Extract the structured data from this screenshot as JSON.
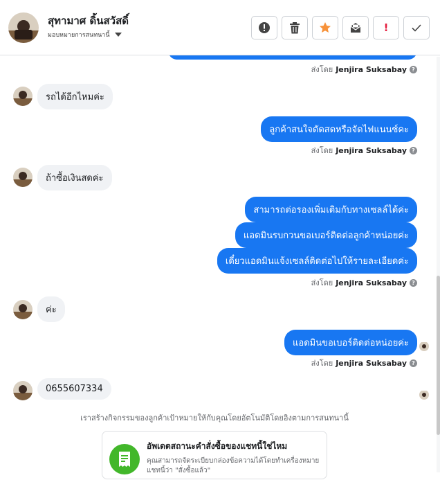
{
  "header": {
    "contact_name": "สุทามาศ ดิ้นสวัสดิ์",
    "assign_label": "มอบหมายการสนทนานี้"
  },
  "toolbar": {
    "buttons": [
      "info",
      "delete",
      "star",
      "mark-unread",
      "spam",
      "done"
    ],
    "spam_label": "!"
  },
  "messages": {
    "sender_prefix": "ส่งโดย",
    "sender_name": "Jenjira Suksabay",
    "help": "?",
    "m1": "รถได้อีกไหมค่ะ",
    "m2": "ลูกค้าสนใจดัดสดหรือจัดไฟแนนซ์คะ",
    "m3": "ถ้าซื้อเงินสดค่ะ",
    "m4": "สามารถต่อรองเพิ่มเติมกับทางเซลล์ได้ค่ะ",
    "m5": "แอดมินรบกวนขอเบอร์ติดต่อลูกค้าหน่อยค่ะ",
    "m6": "เดี๋ยวแอดมินแจ้งเซลล์ติดต่อไปให้รายละเอียดค่ะ",
    "m7": "ค่ะ",
    "m8": "แอดมินขอเบอร์ติดต่อหน่อยค่ะ",
    "m9": "0655607334"
  },
  "activity_note": "เราสร้างกิจกรรมของลูกค้าเป้าหมายให้กับคุณโดยอัตโนมัติโดยอิงตามการสนทนานี้",
  "order_card": {
    "title": "อัพเดตสถานะคำสั่งซื้อของแชทนี้ใช่ไหม",
    "description": "คุณสามารถจัดระเบียบกล่องข้อความได้โดยทำเครื่องหมายแชทนี้ว่า \"สั่งซื้อแล้ว\""
  },
  "colors": {
    "outgoing": "#1877f2",
    "incoming": "#f0f2f5",
    "accent_green": "#42b72a",
    "star": "#f7923a",
    "spam": "#e41e3f"
  }
}
